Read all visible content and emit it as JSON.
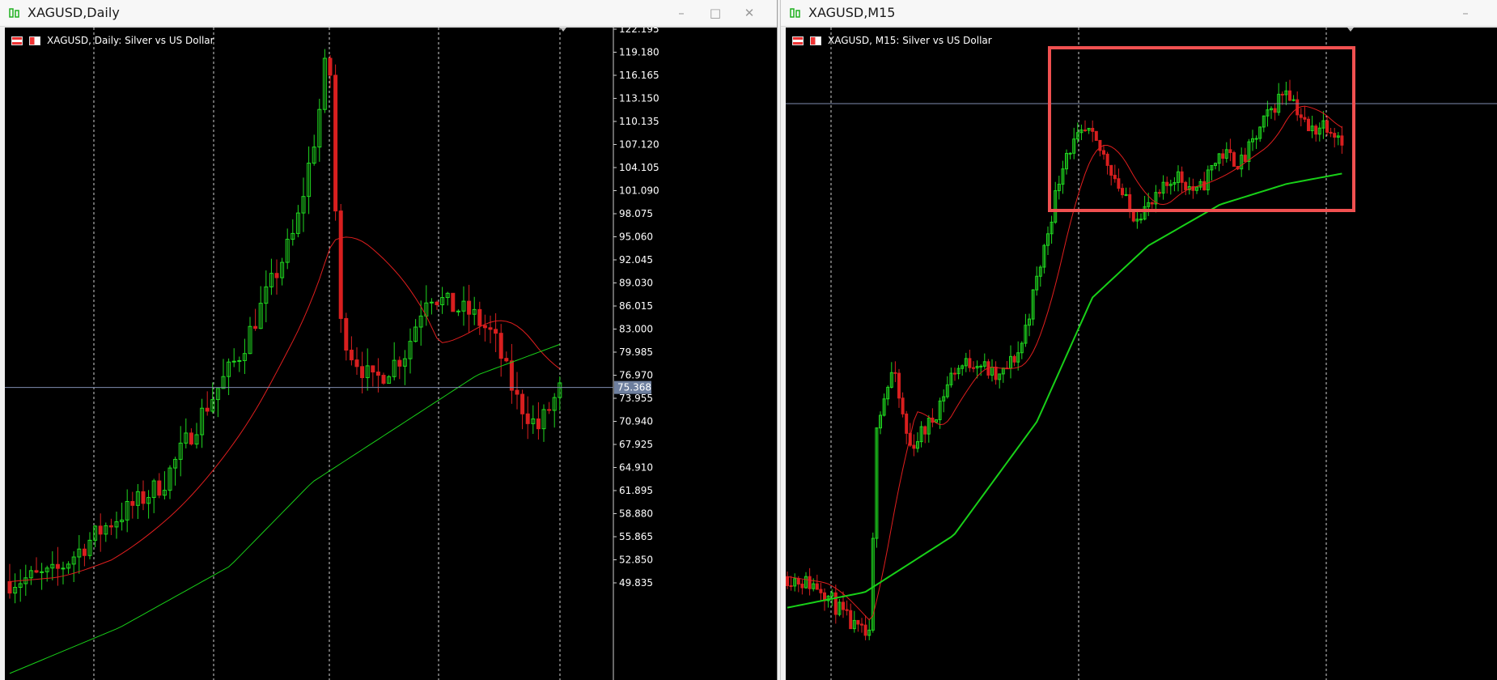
{
  "colors": {
    "bull": "#1fd81f",
    "bear": "#d81f1f",
    "ma_fast": "#e01e1e",
    "ma_slow": "#18d018",
    "grid": "#d0d0d0",
    "bid_line": "#7f8db0",
    "highlight_box": "#f05050",
    "chart_bg": "#000000"
  },
  "left_window": {
    "title": "XAGUSD,Daily",
    "chart_title": "XAGUSD, Daily:  Silver vs US Dollar",
    "current_price": "75.368",
    "price_axis": [
      "122.195",
      "119.180",
      "116.165",
      "113.150",
      "110.135",
      "107.120",
      "104.105",
      "101.090",
      "98.075",
      "95.060",
      "92.045",
      "89.030",
      "86.015",
      "83.000",
      "79.985",
      "76.970",
      "73.955",
      "70.940",
      "67.925",
      "64.910",
      "61.895",
      "58.880",
      "55.865",
      "52.850",
      "49.835"
    ],
    "icons": [
      "bars-icon",
      "candles-icon",
      "minimize-icon",
      "maximize-icon",
      "close-icon"
    ]
  },
  "right_window": {
    "title": "XAGUSD,M15",
    "chart_title": "XAGUSD, M15:  Silver vs US Dollar",
    "icons": [
      "bars-icon",
      "candles-icon",
      "minimize-icon"
    ]
  }
}
